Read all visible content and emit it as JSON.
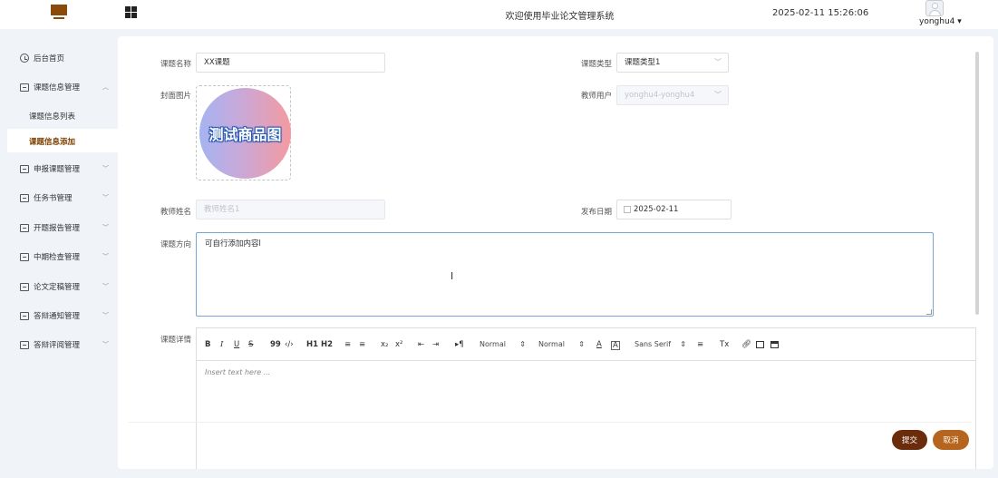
{
  "header": {
    "site_title": "欢迎使用毕业论文管理系统",
    "datetime": "2025-02-11 15:26:06",
    "username": "yonghu4"
  },
  "sidebar": {
    "items": [
      {
        "label": "后台首页",
        "icon": "clock-icon"
      },
      {
        "label": "课题信息管理",
        "icon": "box-icon",
        "expanded": true
      },
      {
        "label": "课题信息列表"
      },
      {
        "label": "课题信息添加",
        "active": true
      },
      {
        "label": "申报课题管理",
        "icon": "box-icon"
      },
      {
        "label": "任务书管理",
        "icon": "box-icon"
      },
      {
        "label": "开题报告管理",
        "icon": "box-icon"
      },
      {
        "label": "中期检查管理",
        "icon": "box-icon"
      },
      {
        "label": "论文定稿管理",
        "icon": "box-icon"
      },
      {
        "label": "答辩通知管理",
        "icon": "box-icon"
      },
      {
        "label": "答辩评阅管理",
        "icon": "box-icon"
      }
    ]
  },
  "form": {
    "topic_name_label": "课题名称",
    "topic_name_value": "XX课题",
    "topic_type_label": "课题类型",
    "topic_type_value": "课题类型1",
    "cover_label": "封面图片",
    "cover_image_text": "测试商品图",
    "teacher_user_label": "教师用户",
    "teacher_user_value": "yonghu4-yonghu4",
    "teacher_name_label": "教师姓名",
    "teacher_name_placeholder": "教师姓名1",
    "publish_date_label": "发布日期",
    "publish_date_value": "2025-02-11",
    "direction_label": "课题方向",
    "direction_value": "可自行添加内容l",
    "detail_label": "课题详情",
    "editor_placeholder": "Insert text here ..."
  },
  "toolbar": {
    "bold": "B",
    "italic": "I",
    "underline": "U",
    "strike": "S",
    "quote": "99",
    "code": "‹/›",
    "h1": "H1",
    "h2": "H2",
    "ol": "≡",
    "ul": "≡",
    "sub": "x₂",
    "sup": "x²",
    "outdent": "⇤",
    "indent": "⇥",
    "direction": "▸¶",
    "size1": "Normal",
    "size2": "Normal",
    "font": "Sans Serif",
    "color": "A",
    "bg": "A",
    "align": "≡",
    "clean": "Tx"
  },
  "buttons": {
    "submit": "提交",
    "cancel": "取消"
  }
}
